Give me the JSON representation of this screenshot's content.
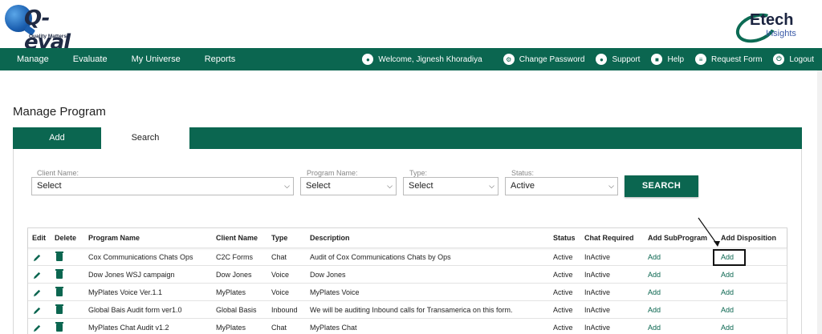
{
  "header": {
    "logo_word": "Q-eval",
    "logo_tagline": "Quality Matters",
    "partner_logo_word": "Etech",
    "partner_logo_sub": "Insights"
  },
  "nav": {
    "left": [
      "Manage",
      "Evaluate",
      "My Universe",
      "Reports"
    ],
    "welcome": "Welcome, Jignesh Khoradiya",
    "change_password": "Change Password",
    "support": "Support",
    "help": "Help",
    "request_form": "Request Form",
    "logout": "Logout",
    "icons": {
      "welcome": "user-icon",
      "change_password": "gear-icon",
      "support": "headset-icon",
      "help": "book-icon",
      "request_form": "form-icon",
      "logout": "power-icon"
    },
    "accent": "#0b6650"
  },
  "page_title": "Manage Program",
  "tabs": {
    "add": "Add",
    "search": "Search"
  },
  "filters": {
    "client_label": "Client Name:",
    "client_value": "Select",
    "program_label": "Program Name:",
    "program_value": "Select",
    "type_label": "Type:",
    "type_value": "Select",
    "status_label": "Status:",
    "status_value": "Active",
    "search_button": "SEARCH"
  },
  "table": {
    "headers": [
      "Edit",
      "Delete",
      "Program Name",
      "Client Name",
      "Type",
      "Description",
      "Status",
      "Chat Required",
      "Add SubProgram",
      "Add Disposition"
    ],
    "rows": [
      {
        "program": "Cox Communications Chats Ops",
        "client": "C2C Forms",
        "type": "Chat",
        "description": "Audit of Cox Communications Chats by Ops",
        "status": "Active",
        "chat_required": "InActive",
        "add_sub": "Add",
        "add_disp": "Add"
      },
      {
        "program": "Dow Jones WSJ campaign",
        "client": "Dow Jones",
        "type": "Voice",
        "description": "Dow Jones",
        "status": "Active",
        "chat_required": "InActive",
        "add_sub": "Add",
        "add_disp": "Add"
      },
      {
        "program": "MyPlates Voice Ver.1.1",
        "client": "MyPlates",
        "type": "Voice",
        "description": "MyPlates Voice",
        "status": "Active",
        "chat_required": "InActive",
        "add_sub": "Add",
        "add_disp": "Add"
      },
      {
        "program": "Global Bais Audit form ver1.0",
        "client": "Global Basis",
        "type": "Inbound",
        "description": "We will be auditing Inbound calls for Transamerica on this form.",
        "status": "Active",
        "chat_required": "InActive",
        "add_sub": "Add",
        "add_disp": "Add"
      },
      {
        "program": "MyPlates Chat Audit v1.2",
        "client": "MyPlates",
        "type": "Chat",
        "description": "MyPlates Chat",
        "status": "Active",
        "chat_required": "InActive",
        "add_sub": "Add",
        "add_disp": "Add"
      }
    ]
  }
}
